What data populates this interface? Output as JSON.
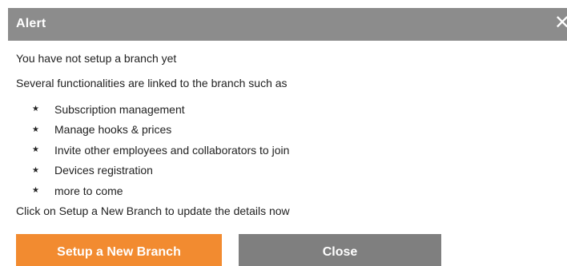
{
  "dialog": {
    "title": "Alert",
    "close_glyph": "✕",
    "message_line_1": "You have not setup a branch yet",
    "message_line_2": "Several functionalities are linked to the branch such as",
    "bullet_glyph": "★",
    "features": [
      "Subscription management",
      "Manage hooks & prices",
      "Invite other employees and collaborators to join",
      "Devices registration",
      "more to come"
    ],
    "instruction": "Click on Setup a New Branch to update the details now",
    "primary_button": "Setup a New Branch",
    "secondary_button": "Close"
  },
  "colors": {
    "titlebar": "#8c8c8c",
    "primary_button": "#f28b30",
    "secondary_button": "#7f7f7f",
    "text": "#222222"
  },
  "icons": {
    "close": "close-icon",
    "bullet": "star-bullet-icon"
  }
}
